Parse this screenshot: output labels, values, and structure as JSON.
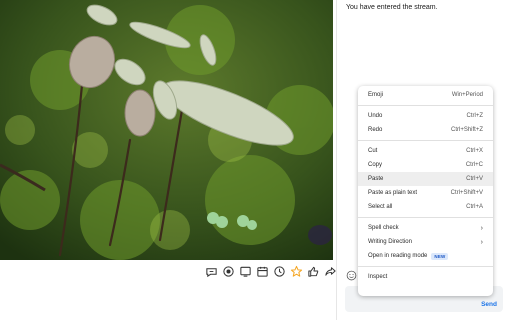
{
  "chat": {
    "message": "You have entered the stream.",
    "send_label": "Send"
  },
  "actions": [
    {
      "name": "live-captions-icon"
    },
    {
      "name": "record-icon"
    },
    {
      "name": "share-screen-icon"
    },
    {
      "name": "calendar-icon"
    },
    {
      "name": "clock-icon"
    },
    {
      "name": "star-icon"
    },
    {
      "name": "thumbs-up-icon"
    },
    {
      "name": "share-arrow-icon"
    }
  ],
  "context_menu": {
    "emoji": {
      "label": "Emoji",
      "shortcut": "Win+Period"
    },
    "undo": {
      "label": "Undo",
      "shortcut": "Ctrl+Z"
    },
    "redo": {
      "label": "Redo",
      "shortcut": "Ctrl+Shift+Z"
    },
    "cut": {
      "label": "Cut",
      "shortcut": "Ctrl+X"
    },
    "copy": {
      "label": "Copy",
      "shortcut": "Ctrl+C"
    },
    "paste": {
      "label": "Paste",
      "shortcut": "Ctrl+V"
    },
    "paste_plain": {
      "label": "Paste as plain text",
      "shortcut": "Ctrl+Shift+V"
    },
    "select_all": {
      "label": "Select all",
      "shortcut": "Ctrl+A"
    },
    "spell_check": {
      "label": "Spell check"
    },
    "writing_direction": {
      "label": "Writing Direction"
    },
    "reading_mode": {
      "label": "Open in reading mode",
      "badge": "NEW"
    },
    "inspect": {
      "label": "Inspect"
    }
  },
  "colors": {
    "accent": "#1a73e8",
    "star": "#f5a623"
  }
}
